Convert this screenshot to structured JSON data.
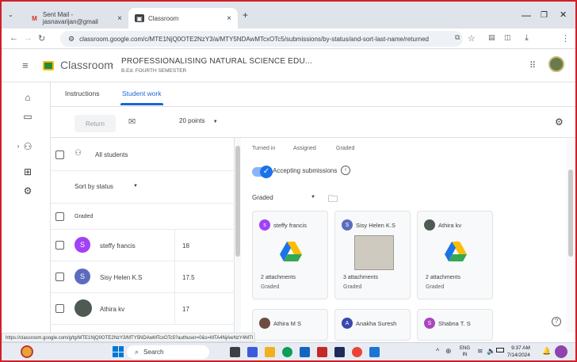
{
  "browser": {
    "tabs": [
      {
        "label": "Sent Mail - jasnavarijan@gmail",
        "icon": "gmail-icon"
      },
      {
        "label": "Classroom",
        "icon": "classroom-icon"
      }
    ],
    "new_tab": "+",
    "url": "classroom.google.com/c/MTE1NjQ0OTE2NzY3/a/MTY5NDAwMTcxOTc5/submissions/by-status/and-sort-last-name/returned",
    "window_controls": [
      "—",
      "❐",
      "✕"
    ]
  },
  "header": {
    "brand": "Classroom",
    "course_title": "PROFESSIONALISING NATURAL SCIENCE EDU...",
    "course_subtitle": "B.Ed. FOURTH SEMESTER"
  },
  "nav": {
    "tabs": [
      "Instructions",
      "Student work"
    ],
    "active": "Student work"
  },
  "toolbar": {
    "return_label": "Return",
    "points_label": "20 points"
  },
  "student_list": {
    "all_students_label": "All students",
    "sort_label": "Sort by status",
    "section_label": "Graded",
    "students": [
      {
        "name": "steffy francis",
        "initial": "S",
        "grade": "18",
        "color": "#a142f4"
      },
      {
        "name": "Sisy Helen K.S",
        "initial": "S",
        "grade": "17.5",
        "color": "#5c6bc0"
      },
      {
        "name": "Athira kv",
        "initial": "",
        "grade": "17",
        "color": "#4e5a52"
      }
    ]
  },
  "right_panel": {
    "status_labels": [
      "Turned in",
      "Assigned",
      "Graded"
    ],
    "accepting_label": "Accepting submissions",
    "filter_label": "Graded",
    "cards": [
      {
        "name": "steffy francis",
        "initial": "s",
        "color": "#a142f4",
        "attachments": "2 attachments",
        "status": "Graded",
        "thumb": "drive"
      },
      {
        "name": "Sisy Helen K.S",
        "initial": "S",
        "color": "#5c6bc0",
        "attachments": "3 attachments",
        "status": "Graded",
        "thumb": "photo"
      },
      {
        "name": "Athira kv",
        "initial": "",
        "color": "#4e5a52",
        "attachments": "2 attachments",
        "status": "Graded",
        "thumb": "drive"
      },
      {
        "name": "Athira M S",
        "initial": "",
        "color": "#6d4c41"
      },
      {
        "name": "Anakha Suresh",
        "initial": "A",
        "color": "#3949ab"
      },
      {
        "name": "Shabna T. S",
        "initial": "S",
        "color": "#ab47bc"
      }
    ]
  },
  "status_url": "https://classroom.google.com/g/tg/MTE1NjQ0OTE2NzY3/MTY5NDAwMTcxOTc5?authuser=0&s=MTA4NjAwNzY4MTI",
  "taskbar": {
    "search_label": "Search",
    "lang_line1": "ENG",
    "lang_line2": "IN",
    "time": "9:37 AM",
    "date": "7/14/2024"
  },
  "colors": {
    "accent": "#1967d2",
    "frame": "#d11f26"
  }
}
